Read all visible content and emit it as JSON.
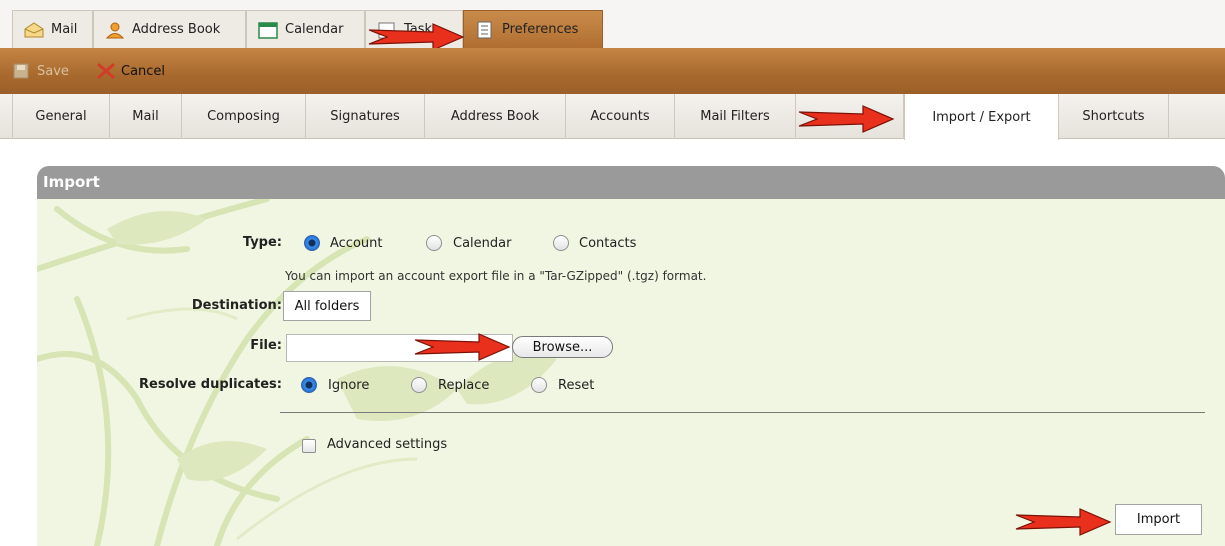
{
  "app_tabs": [
    {
      "label": "Mail",
      "icon": "envelope-icon"
    },
    {
      "label": "Address Book",
      "icon": "contacts-icon"
    },
    {
      "label": "Calendar",
      "icon": "calendar-icon"
    },
    {
      "label": "Tasks",
      "icon": "tasks-icon"
    },
    {
      "label": "Preferences",
      "icon": "preferences-icon",
      "active": true
    }
  ],
  "toolbar": {
    "save_label": "Save",
    "cancel_label": "Cancel"
  },
  "pref_tabs": [
    {
      "label": "General"
    },
    {
      "label": "Mail"
    },
    {
      "label": "Composing"
    },
    {
      "label": "Signatures"
    },
    {
      "label": "Address Book"
    },
    {
      "label": "Accounts"
    },
    {
      "label": "Mail Filters"
    },
    {
      "label": "Import / Export",
      "active": true
    },
    {
      "label": "Shortcuts"
    }
  ],
  "import": {
    "title": "Import",
    "type_label": "Type:",
    "type_options": [
      "Account",
      "Calendar",
      "Contacts"
    ],
    "type_selected": "Account",
    "type_hint": "You can import an account export file in a \"Tar-GZipped\" (.tgz) format.",
    "destination_label": "Destination:",
    "destination_button": "All folders",
    "file_label": "File:",
    "file_value": "",
    "browse_button": "Browse...",
    "resolve_label": "Resolve duplicates:",
    "resolve_options": [
      "Ignore",
      "Replace",
      "Reset"
    ],
    "resolve_selected": "Ignore",
    "advanced_label": "Advanced settings",
    "advanced_checked": false,
    "import_button": "Import"
  },
  "colors": {
    "active_tab": "#b87a3c",
    "toolbar": "#a8692e",
    "panel_header": "#9a9a9a",
    "panel_body": "#f1f6e2",
    "annotation_arrow": "#e8301c",
    "radio_selected": "#1b6ad0"
  }
}
